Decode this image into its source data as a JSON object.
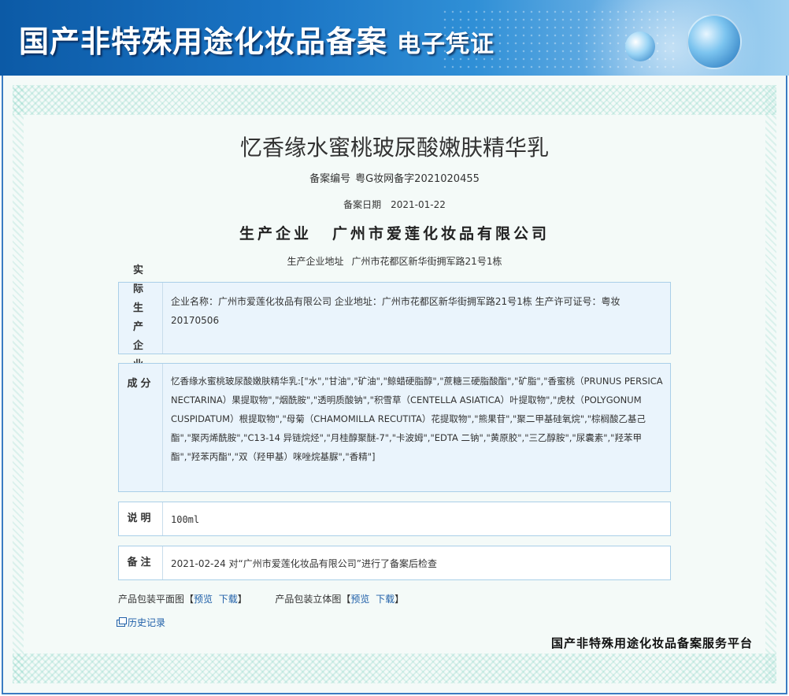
{
  "banner": {
    "title": "国产非特殊用途化妆品备案",
    "subtitle": "电子凭证"
  },
  "product": {
    "name": "忆香缘水蜜桃玻尿酸嫩肤精华乳",
    "record_no_label": "备案编号",
    "record_no": "粤G妆网备字2021020455",
    "record_date_label": "备案日期",
    "record_date": "2021-01-22",
    "manufacturer_label": "生产企业",
    "manufacturer": "广州市爱莲化妆品有限公司",
    "address_label": "生产企业地址",
    "address": "广州市花都区新华街拥军路21号1栋"
  },
  "sections": {
    "actual": {
      "head": "实际生产企业",
      "text": "企业名称：广州市爱莲化妆品有限公司   企业地址：广州市花都区新华街拥军路21号1栋   生产许可证号：粤妆20170506"
    },
    "ingredients": {
      "head": "成分",
      "text": "忆香缘水蜜桃玻尿酸嫩肤精华乳:[\"水\",\"甘油\",\"矿油\",\"鲸蜡硬脂醇\",\"蔗糖三硬脂酸酯\",\"矿脂\",\"香蜜桃（PRUNUS PERSICA NECTARINA）果提取物\",\"烟酰胺\",\"透明质酸钠\",\"积雪草（CENTELLA ASIATICA）叶提取物\",\"虎杖（POLYGONUM CUSPIDATUM）根提取物\",\"母菊（CHAMOMILLA RECUTITA）花提取物\",\"熊果苷\",\"聚二甲基硅氧烷\",\"棕榈酸乙基己酯\",\"聚丙烯酰胺\",\"C13-14 异链烷烃\",\"月桂醇聚醚-7\",\"卡波姆\",\"EDTA 二钠\",\"黄原胶\",\"三乙醇胺\",\"尿囊素\",\"羟苯甲酯\",\"羟苯丙酯\",\"双（羟甲基）咪唑烷基脲\",\"香精\"]"
    },
    "note": {
      "head": "说明",
      "text": "100ml"
    },
    "remark": {
      "head": "备注",
      "text": "2021-02-24 对“广州市爱莲化妆品有限公司”进行了备案后检查"
    }
  },
  "package": {
    "flat_label": "产品包装平面图",
    "solid_label": "产品包装立体图",
    "preview": "预览",
    "download": "下载",
    "open_bracket": "【",
    "close_bracket": "】"
  },
  "history_link": "历史记录",
  "platform": "国产非特殊用途化妆品备案服务平台"
}
